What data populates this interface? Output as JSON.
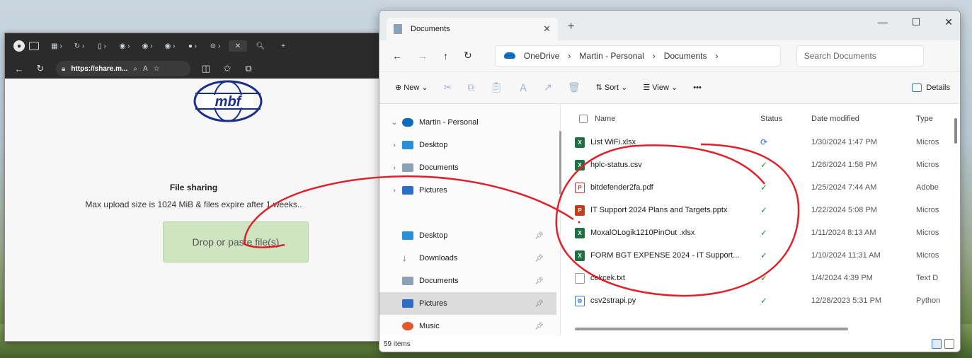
{
  "browser": {
    "address_host": "https://share.m...",
    "page": {
      "title": "File sharing",
      "subtitle": "Max upload size is 1024 MiB & files expire after 1 weeks..",
      "drop_label": "Drop or paste file(s)",
      "logo_text": "mbf"
    }
  },
  "explorer": {
    "tab_title": "Documents",
    "breadcrumb": [
      "OneDrive",
      "Martin - Personal",
      "Documents"
    ],
    "search_placeholder": "Search Documents",
    "toolbar": {
      "new_label": "New",
      "sort_label": "Sort",
      "view_label": "View",
      "more_label": "•••",
      "details_label": "Details"
    },
    "nav_tree": [
      {
        "label": "Martin - Personal",
        "icon": "onedrive-icon",
        "expanded": true
      },
      {
        "label": "Desktop",
        "icon": "desktop-folder-icon"
      },
      {
        "label": "Documents",
        "icon": "documents-folder-icon"
      },
      {
        "label": "Pictures",
        "icon": "pictures-folder-icon"
      }
    ],
    "quick_access": [
      {
        "label": "Desktop",
        "icon": "desktop-folder-icon"
      },
      {
        "label": "Downloads",
        "icon": "downloads-icon"
      },
      {
        "label": "Documents",
        "icon": "documents-folder-icon"
      },
      {
        "label": "Pictures",
        "icon": "pictures-folder-icon",
        "selected": true
      },
      {
        "label": "Music",
        "icon": "music-icon"
      }
    ],
    "columns": [
      "Name",
      "Status",
      "Date modified",
      "Type"
    ],
    "files": [
      {
        "name": "List WiFi.xlsx",
        "status": "syncing",
        "date": "1/30/2024 1:47 PM",
        "type": "Micros",
        "kind": "xlsx"
      },
      {
        "name": "hplc-status.csv",
        "status": "synced",
        "date": "1/26/2024 1:58 PM",
        "type": "Micros",
        "kind": "xlsx"
      },
      {
        "name": "bitdefender2fa.pdf",
        "status": "synced",
        "date": "1/25/2024 7:44 AM",
        "type": "Adobe",
        "kind": "pdf"
      },
      {
        "name": "IT Support 2024 Plans and Targets.pptx",
        "status": "synced",
        "date": "1/22/2024 5:08 PM",
        "type": "Micros",
        "kind": "pptx"
      },
      {
        "name": "MoxalOLogik1210PinOut .xlsx",
        "status": "synced",
        "date": "1/11/2024 8:13 AM",
        "type": "Micros",
        "kind": "xlsx"
      },
      {
        "name": "FORM BGT EXPENSE 2024 - IT Support...",
        "status": "synced",
        "date": "1/10/2024 11:31 AM",
        "type": "Micros",
        "kind": "xlsx"
      },
      {
        "name": "cekcek.txt",
        "status": "synced",
        "date": "1/4/2024 4:39 PM",
        "type": "Text D",
        "kind": "txt"
      },
      {
        "name": "csv2strapi.py",
        "status": "synced",
        "date": "12/28/2023 5:31 PM",
        "type": "Python",
        "kind": "py"
      }
    ],
    "item_count": "59 items"
  },
  "colors": {
    "excel": "#1e7145",
    "pdf": "#d13438",
    "pptx": "#c43e1c",
    "annotation": "#e0202a",
    "drop_bg": "#cfe5c2"
  }
}
